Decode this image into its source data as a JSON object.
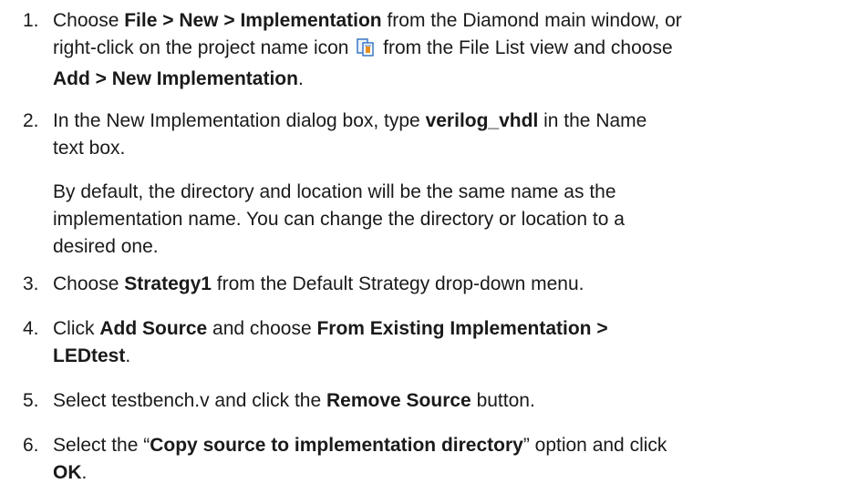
{
  "steps": [
    {
      "num": "1.",
      "l1_a": "Choose ",
      "l1_b": "File > New > Implementation",
      "l1_c": " from the Diamond main window, or",
      "l2_a": "right-click on the project name icon ",
      "l2_icon": "project-file-icon",
      "l2_b": " from the File List view and choose",
      "l3_a": "Add > New Implementation",
      "l3_b": "."
    },
    {
      "num": "2.",
      "l1_a": "In the New Implementation dialog box, type ",
      "l1_b": "verilog_vhdl",
      "l1_c": " in the Name",
      "l2_a": "text box."
    },
    {
      "para_l1": "By default, the directory and location will be the same name as the",
      "para_l2": "implementation name. You can change the directory or location to a",
      "para_l3": "desired one."
    },
    {
      "num": "3.",
      "l1_a": "Choose ",
      "l1_b": "Strategy1",
      "l1_c": " from the Default Strategy drop-down menu."
    },
    {
      "num": "4.",
      "l1_a": "Click ",
      "l1_b": "Add Source",
      "l1_c": " and choose ",
      "l1_d": "From Existing Implementation >",
      "l2_a": "LEDtest",
      "l2_b": "."
    },
    {
      "num": "5.",
      "l1_a": "Select testbench.v and click the ",
      "l1_b": "Remove Source",
      "l1_c": " button."
    },
    {
      "num": "6.",
      "l1_a": "Select the “",
      "l1_b": "Copy source to implementation directory",
      "l1_c": "” option and click",
      "l2_a": "OK",
      "l2_b": "."
    }
  ],
  "colors": {
    "text": "#1a1a1a",
    "icon_blue": "#3a78c4",
    "icon_orange": "#e8901e"
  }
}
